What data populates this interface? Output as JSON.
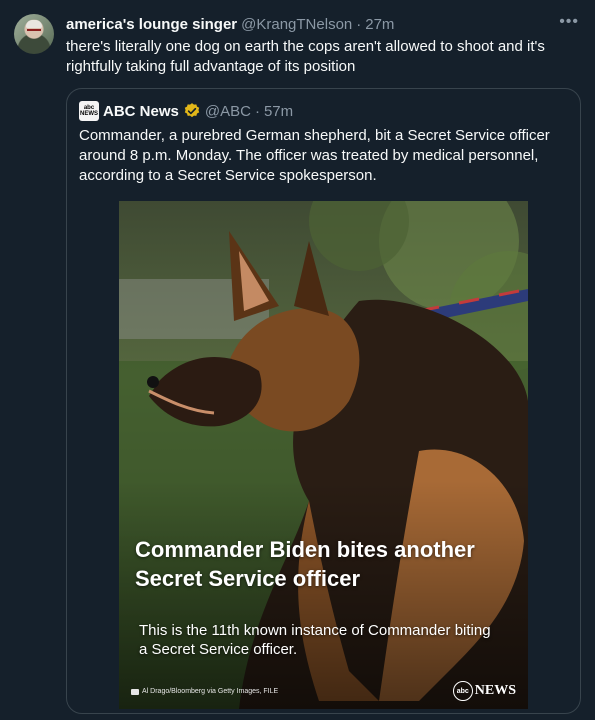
{
  "tweet": {
    "display_name": "america's lounge singer",
    "handle": "@KrangTNelson",
    "separator": "·",
    "time": "27m",
    "more_icon": "more-horizontal-icon",
    "text": "there's literally one dog on earth the cops aren't allowed to shoot and it's rightfully taking full advantage of its position"
  },
  "quote": {
    "avatar_text_top": "abc",
    "avatar_text_bottom": "NEWS",
    "display_name": "ABC News",
    "verified_icon": "gold-verified-badge-icon",
    "verified_color": "#e2b719",
    "handle": "@ABC",
    "separator": "·",
    "time": "57m",
    "text": "Commander, a purebred German shepherd, bit a Secret Service officer around 8 p.m. Monday. The officer was treated by medical personnel, according to a Secret Service spokesperson.",
    "media": {
      "headline": "Commander Biden bites another Secret Service officer",
      "subhead": "This is the 11th known instance of Commander biting a Secret Service officer.",
      "credit": "Al Drago/Bloomberg via Getty Images, FILE",
      "logo_mark": "abc",
      "logo_text": "NEWS"
    }
  },
  "colors": {
    "background": "#15202b",
    "text": "#f7f9f9",
    "muted": "#8b98a5",
    "border": "#38444d"
  }
}
